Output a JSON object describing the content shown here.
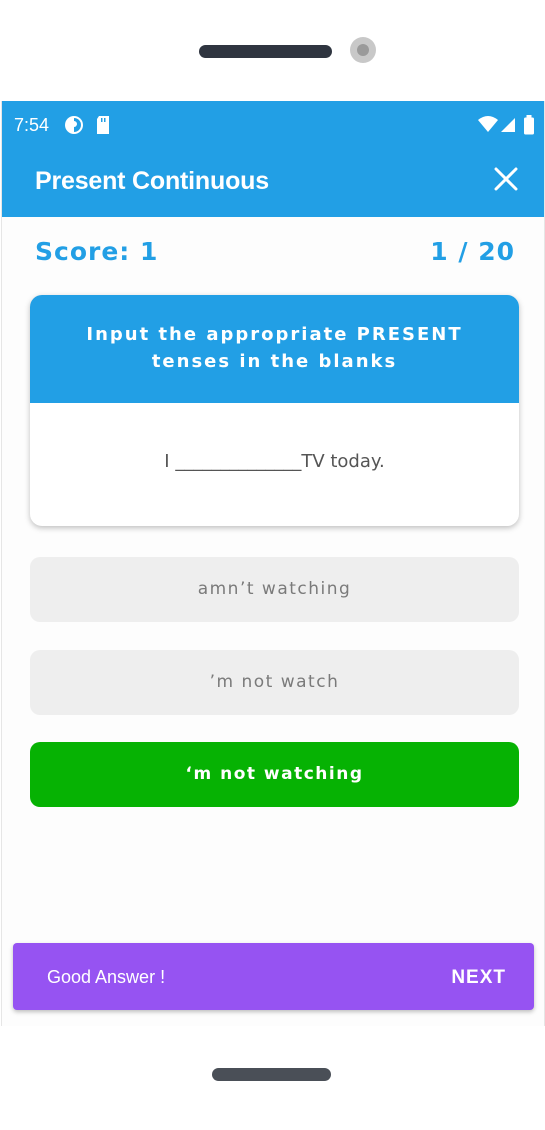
{
  "status_bar": {
    "time": "7:54",
    "icons": [
      "app-notification-icon",
      "sd-card-icon",
      "wifi-icon",
      "signal-icon",
      "battery-icon"
    ]
  },
  "app_bar": {
    "title": "Present Continuous",
    "close_icon": "close-icon"
  },
  "quiz": {
    "score_text": "Score: 1",
    "progress_text": "1 / 20",
    "instruction": "Input the appropriate PRESENT tenses in the blanks",
    "sentence": "I ______________TV today."
  },
  "options": [
    {
      "label": "amn’t watching",
      "state": "default"
    },
    {
      "label": "’m not watch",
      "state": "default"
    },
    {
      "label": "‘m not watching",
      "state": "correct"
    }
  ],
  "snackbar": {
    "message": "Good Answer !",
    "action": "NEXT"
  },
  "colors": {
    "primary": "#229fe5",
    "correct": "#06b203",
    "option_bg": "#eeeeee",
    "snackbar": "#9653f2"
  }
}
